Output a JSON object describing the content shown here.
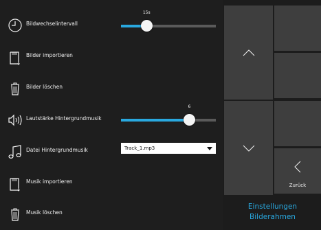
{
  "settings": {
    "slideshow_interval": {
      "label": "Bildwechselintervall",
      "value_text": "15s",
      "level": 0.27
    },
    "import_images": {
      "label": "Bilder importieren"
    },
    "delete_images": {
      "label": "Bilder löschen"
    },
    "music_volume": {
      "label": "Lautstärke Hintergrundmusik",
      "value_text": "6",
      "level": 0.72
    },
    "music_file": {
      "label": "Datei Hintergrundmusik",
      "selected": "Track_1.mp3"
    },
    "import_music": {
      "label": "Musik importieren"
    },
    "delete_music": {
      "label": "Musik löschen"
    }
  },
  "nav": {
    "back_label": "Zurück",
    "title_line1": "Einstellungen",
    "title_line2": "Bilderahmen"
  },
  "colors": {
    "accent": "#29a8df",
    "button": "#3e3e3e",
    "background": "#1e1e1e"
  },
  "icons": [
    "clock-icon",
    "import-icon",
    "trash-icon",
    "speaker-icon",
    "music-note-icon",
    "chevron-up-icon",
    "chevron-down-icon",
    "chevron-left-icon"
  ]
}
